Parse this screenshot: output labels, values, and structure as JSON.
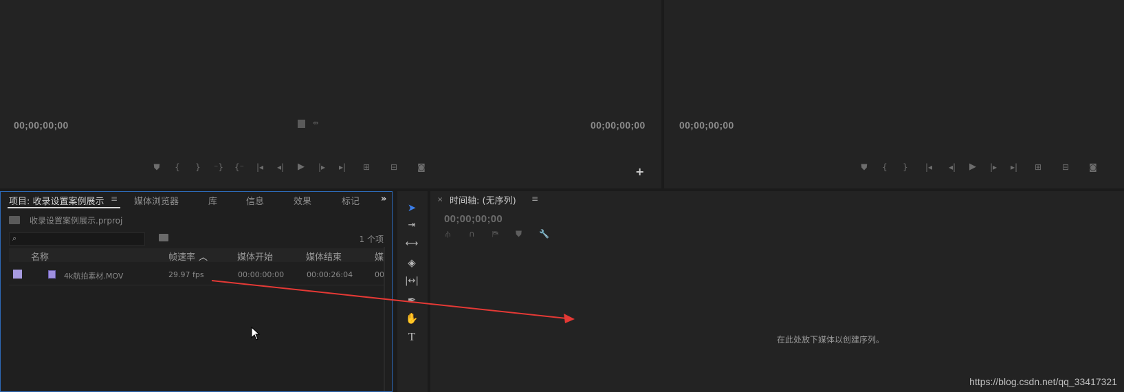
{
  "source_monitor": {
    "timecode_left": "00;00;00;00",
    "timecode_right": "00;00;00;00",
    "controls": [
      "marker-icon",
      "mark-in-icon",
      "mark-out-icon",
      "clear-in-icon",
      "go-to-in-icon",
      "step-back-icon",
      "play-icon",
      "step-forward-icon",
      "go-to-out-icon",
      "insert-icon",
      "overwrite-icon",
      "export-frame-icon"
    ],
    "add_glyph": "+"
  },
  "program_monitor": {
    "timecode_left": "00;00;00;00"
  },
  "project_panel": {
    "tabs": [
      {
        "label": "项目: 收录设置案例展示",
        "active": true
      },
      {
        "label": "媒体浏览器"
      },
      {
        "label": "库"
      },
      {
        "label": "信息"
      },
      {
        "label": "效果"
      },
      {
        "label": "标记"
      }
    ],
    "menu_glyph": "≡",
    "overflow_glyph": "»",
    "project_file": "收录设置案例展示.prproj",
    "search_placeholder": "",
    "item_count": "1 个项",
    "columns": [
      "名称",
      "帧速率",
      "媒体开始",
      "媒体结束",
      "媒"
    ],
    "rows": [
      {
        "name": "4k航拍素材.MOV",
        "frame_rate": "29.97 fps",
        "media_start": "00:00:00:00",
        "media_end": "00:00:26:04",
        "extra": "00"
      }
    ]
  },
  "timeline": {
    "close_glyph": "×",
    "title": "时间轴: (无序列)",
    "menu_glyph": "≡",
    "timecode": "00;00;00;00",
    "drop_hint": "在此处放下媒体以创建序列。"
  },
  "watermark": "https://blog.csdn.net/qq_33417321",
  "colors": {
    "accent": "#2d6ab8",
    "label": "#a79be0",
    "arrow": "#e53935"
  }
}
